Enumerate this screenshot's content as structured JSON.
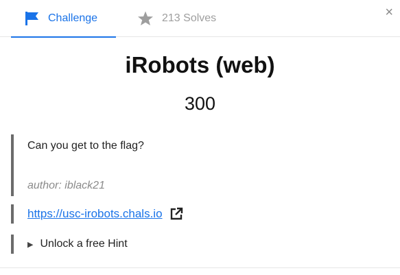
{
  "tabs": {
    "challenge_label": "Challenge",
    "solves_label": "213 Solves"
  },
  "close_glyph": "×",
  "challenge": {
    "title": "iRobots (web)",
    "points": "300",
    "description": "Can you get to the flag?",
    "author": "author: iblack21",
    "link": "https://usc-irobots.chals.io",
    "hint_label": "Unlock a free Hint"
  },
  "colors": {
    "accent": "#1a73e8",
    "muted": "#9e9e9e",
    "quote_bar": "#6b6b6b"
  },
  "icons": {
    "challenge_tab": "flag-icon",
    "solves_tab": "star-icon",
    "link": "external-link-icon",
    "hint": "disclosure-triangle-icon"
  }
}
